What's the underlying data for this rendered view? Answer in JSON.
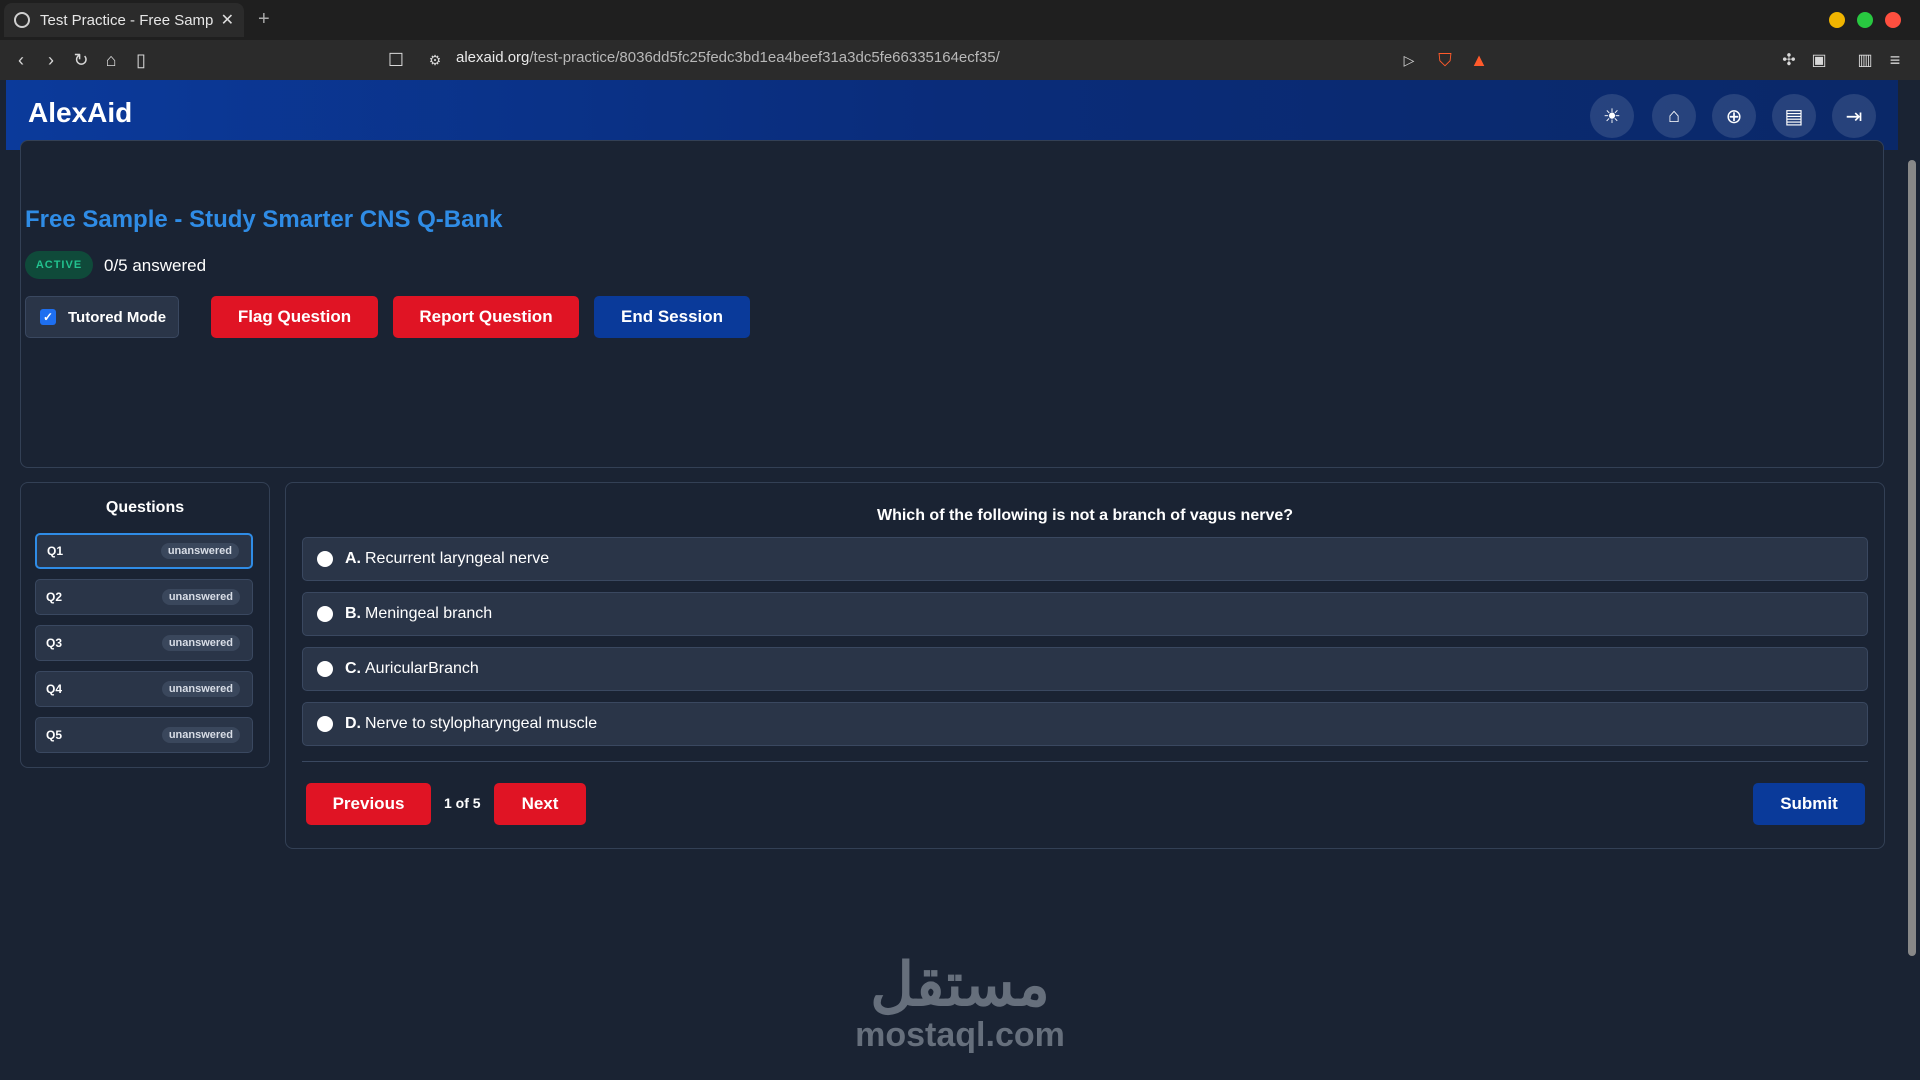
{
  "browser": {
    "tab_title": "Test Practice - Free Sampl",
    "url_domain": "alexaid.org",
    "url_path": "/test-practice/8036dd5fc25fedc3bd1ea4beef31a3dc5fe66335164ecf35/"
  },
  "header": {
    "brand": "AlexAid",
    "icons": [
      "sun-icon",
      "home-icon",
      "plus-circle-icon",
      "clipboard-icon",
      "logout-icon"
    ]
  },
  "session": {
    "title": "Free Sample - Study Smarter CNS Q-Bank",
    "status_badge": "ACTIVE",
    "answered": "0/5 answered",
    "tutored_label": "Tutored Mode",
    "tutored_checked": true,
    "flag_label": "Flag Question",
    "report_label": "Report Question",
    "end_label": "End Session"
  },
  "questions_panel": {
    "title": "Questions",
    "items": [
      {
        "label": "Q1",
        "status": "unanswered"
      },
      {
        "label": "Q2",
        "status": "unanswered"
      },
      {
        "label": "Q3",
        "status": "unanswered"
      },
      {
        "label": "Q4",
        "status": "unanswered"
      },
      {
        "label": "Q5",
        "status": "unanswered"
      }
    ]
  },
  "question": {
    "text": "Which of the following is not a branch of vagus nerve?",
    "options": [
      {
        "letter": "A.",
        "text": "Recurrent laryngeal nerve"
      },
      {
        "letter": "B.",
        "text": "Meningeal branch"
      },
      {
        "letter": "C.",
        "text": "AuricularBranch"
      },
      {
        "letter": "D.",
        "text": "Nerve to stylopharyngeal muscle"
      }
    ]
  },
  "nav": {
    "previous_label": "Previous",
    "page_info": "1 of 5",
    "next_label": "Next",
    "submit_label": "Submit"
  },
  "watermark": {
    "arabic": "مستقل",
    "latin": "mostaql.com"
  },
  "colors": {
    "accent_blue": "#2f8ce6",
    "danger_red": "#e01424",
    "primary_navy": "#0a3a9a",
    "active_green": "#22c28f"
  }
}
